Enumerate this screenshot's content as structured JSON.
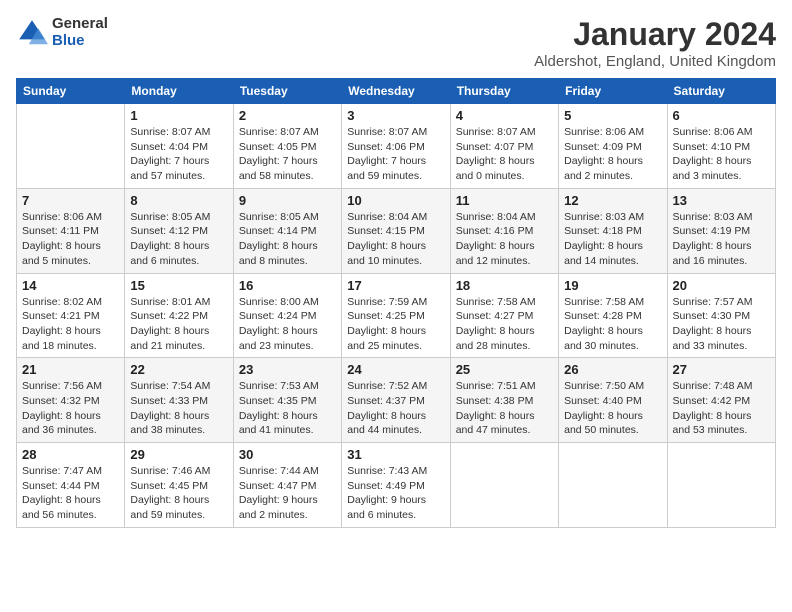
{
  "logo": {
    "general": "General",
    "blue": "Blue"
  },
  "title": "January 2024",
  "location": "Aldershot, England, United Kingdom",
  "days_header": [
    "Sunday",
    "Monday",
    "Tuesday",
    "Wednesday",
    "Thursday",
    "Friday",
    "Saturday"
  ],
  "weeks": [
    [
      {
        "day": "",
        "info": ""
      },
      {
        "day": "1",
        "info": "Sunrise: 8:07 AM\nSunset: 4:04 PM\nDaylight: 7 hours\nand 57 minutes."
      },
      {
        "day": "2",
        "info": "Sunrise: 8:07 AM\nSunset: 4:05 PM\nDaylight: 7 hours\nand 58 minutes."
      },
      {
        "day": "3",
        "info": "Sunrise: 8:07 AM\nSunset: 4:06 PM\nDaylight: 7 hours\nand 59 minutes."
      },
      {
        "day": "4",
        "info": "Sunrise: 8:07 AM\nSunset: 4:07 PM\nDaylight: 8 hours\nand 0 minutes."
      },
      {
        "day": "5",
        "info": "Sunrise: 8:06 AM\nSunset: 4:09 PM\nDaylight: 8 hours\nand 2 minutes."
      },
      {
        "day": "6",
        "info": "Sunrise: 8:06 AM\nSunset: 4:10 PM\nDaylight: 8 hours\nand 3 minutes."
      }
    ],
    [
      {
        "day": "7",
        "info": "Sunrise: 8:06 AM\nSunset: 4:11 PM\nDaylight: 8 hours\nand 5 minutes."
      },
      {
        "day": "8",
        "info": "Sunrise: 8:05 AM\nSunset: 4:12 PM\nDaylight: 8 hours\nand 6 minutes."
      },
      {
        "day": "9",
        "info": "Sunrise: 8:05 AM\nSunset: 4:14 PM\nDaylight: 8 hours\nand 8 minutes."
      },
      {
        "day": "10",
        "info": "Sunrise: 8:04 AM\nSunset: 4:15 PM\nDaylight: 8 hours\nand 10 minutes."
      },
      {
        "day": "11",
        "info": "Sunrise: 8:04 AM\nSunset: 4:16 PM\nDaylight: 8 hours\nand 12 minutes."
      },
      {
        "day": "12",
        "info": "Sunrise: 8:03 AM\nSunset: 4:18 PM\nDaylight: 8 hours\nand 14 minutes."
      },
      {
        "day": "13",
        "info": "Sunrise: 8:03 AM\nSunset: 4:19 PM\nDaylight: 8 hours\nand 16 minutes."
      }
    ],
    [
      {
        "day": "14",
        "info": "Sunrise: 8:02 AM\nSunset: 4:21 PM\nDaylight: 8 hours\nand 18 minutes."
      },
      {
        "day": "15",
        "info": "Sunrise: 8:01 AM\nSunset: 4:22 PM\nDaylight: 8 hours\nand 21 minutes."
      },
      {
        "day": "16",
        "info": "Sunrise: 8:00 AM\nSunset: 4:24 PM\nDaylight: 8 hours\nand 23 minutes."
      },
      {
        "day": "17",
        "info": "Sunrise: 7:59 AM\nSunset: 4:25 PM\nDaylight: 8 hours\nand 25 minutes."
      },
      {
        "day": "18",
        "info": "Sunrise: 7:58 AM\nSunset: 4:27 PM\nDaylight: 8 hours\nand 28 minutes."
      },
      {
        "day": "19",
        "info": "Sunrise: 7:58 AM\nSunset: 4:28 PM\nDaylight: 8 hours\nand 30 minutes."
      },
      {
        "day": "20",
        "info": "Sunrise: 7:57 AM\nSunset: 4:30 PM\nDaylight: 8 hours\nand 33 minutes."
      }
    ],
    [
      {
        "day": "21",
        "info": "Sunrise: 7:56 AM\nSunset: 4:32 PM\nDaylight: 8 hours\nand 36 minutes."
      },
      {
        "day": "22",
        "info": "Sunrise: 7:54 AM\nSunset: 4:33 PM\nDaylight: 8 hours\nand 38 minutes."
      },
      {
        "day": "23",
        "info": "Sunrise: 7:53 AM\nSunset: 4:35 PM\nDaylight: 8 hours\nand 41 minutes."
      },
      {
        "day": "24",
        "info": "Sunrise: 7:52 AM\nSunset: 4:37 PM\nDaylight: 8 hours\nand 44 minutes."
      },
      {
        "day": "25",
        "info": "Sunrise: 7:51 AM\nSunset: 4:38 PM\nDaylight: 8 hours\nand 47 minutes."
      },
      {
        "day": "26",
        "info": "Sunrise: 7:50 AM\nSunset: 4:40 PM\nDaylight: 8 hours\nand 50 minutes."
      },
      {
        "day": "27",
        "info": "Sunrise: 7:48 AM\nSunset: 4:42 PM\nDaylight: 8 hours\nand 53 minutes."
      }
    ],
    [
      {
        "day": "28",
        "info": "Sunrise: 7:47 AM\nSunset: 4:44 PM\nDaylight: 8 hours\nand 56 minutes."
      },
      {
        "day": "29",
        "info": "Sunrise: 7:46 AM\nSunset: 4:45 PM\nDaylight: 8 hours\nand 59 minutes."
      },
      {
        "day": "30",
        "info": "Sunrise: 7:44 AM\nSunset: 4:47 PM\nDaylight: 9 hours\nand 2 minutes."
      },
      {
        "day": "31",
        "info": "Sunrise: 7:43 AM\nSunset: 4:49 PM\nDaylight: 9 hours\nand 6 minutes."
      },
      {
        "day": "",
        "info": ""
      },
      {
        "day": "",
        "info": ""
      },
      {
        "day": "",
        "info": ""
      }
    ]
  ]
}
